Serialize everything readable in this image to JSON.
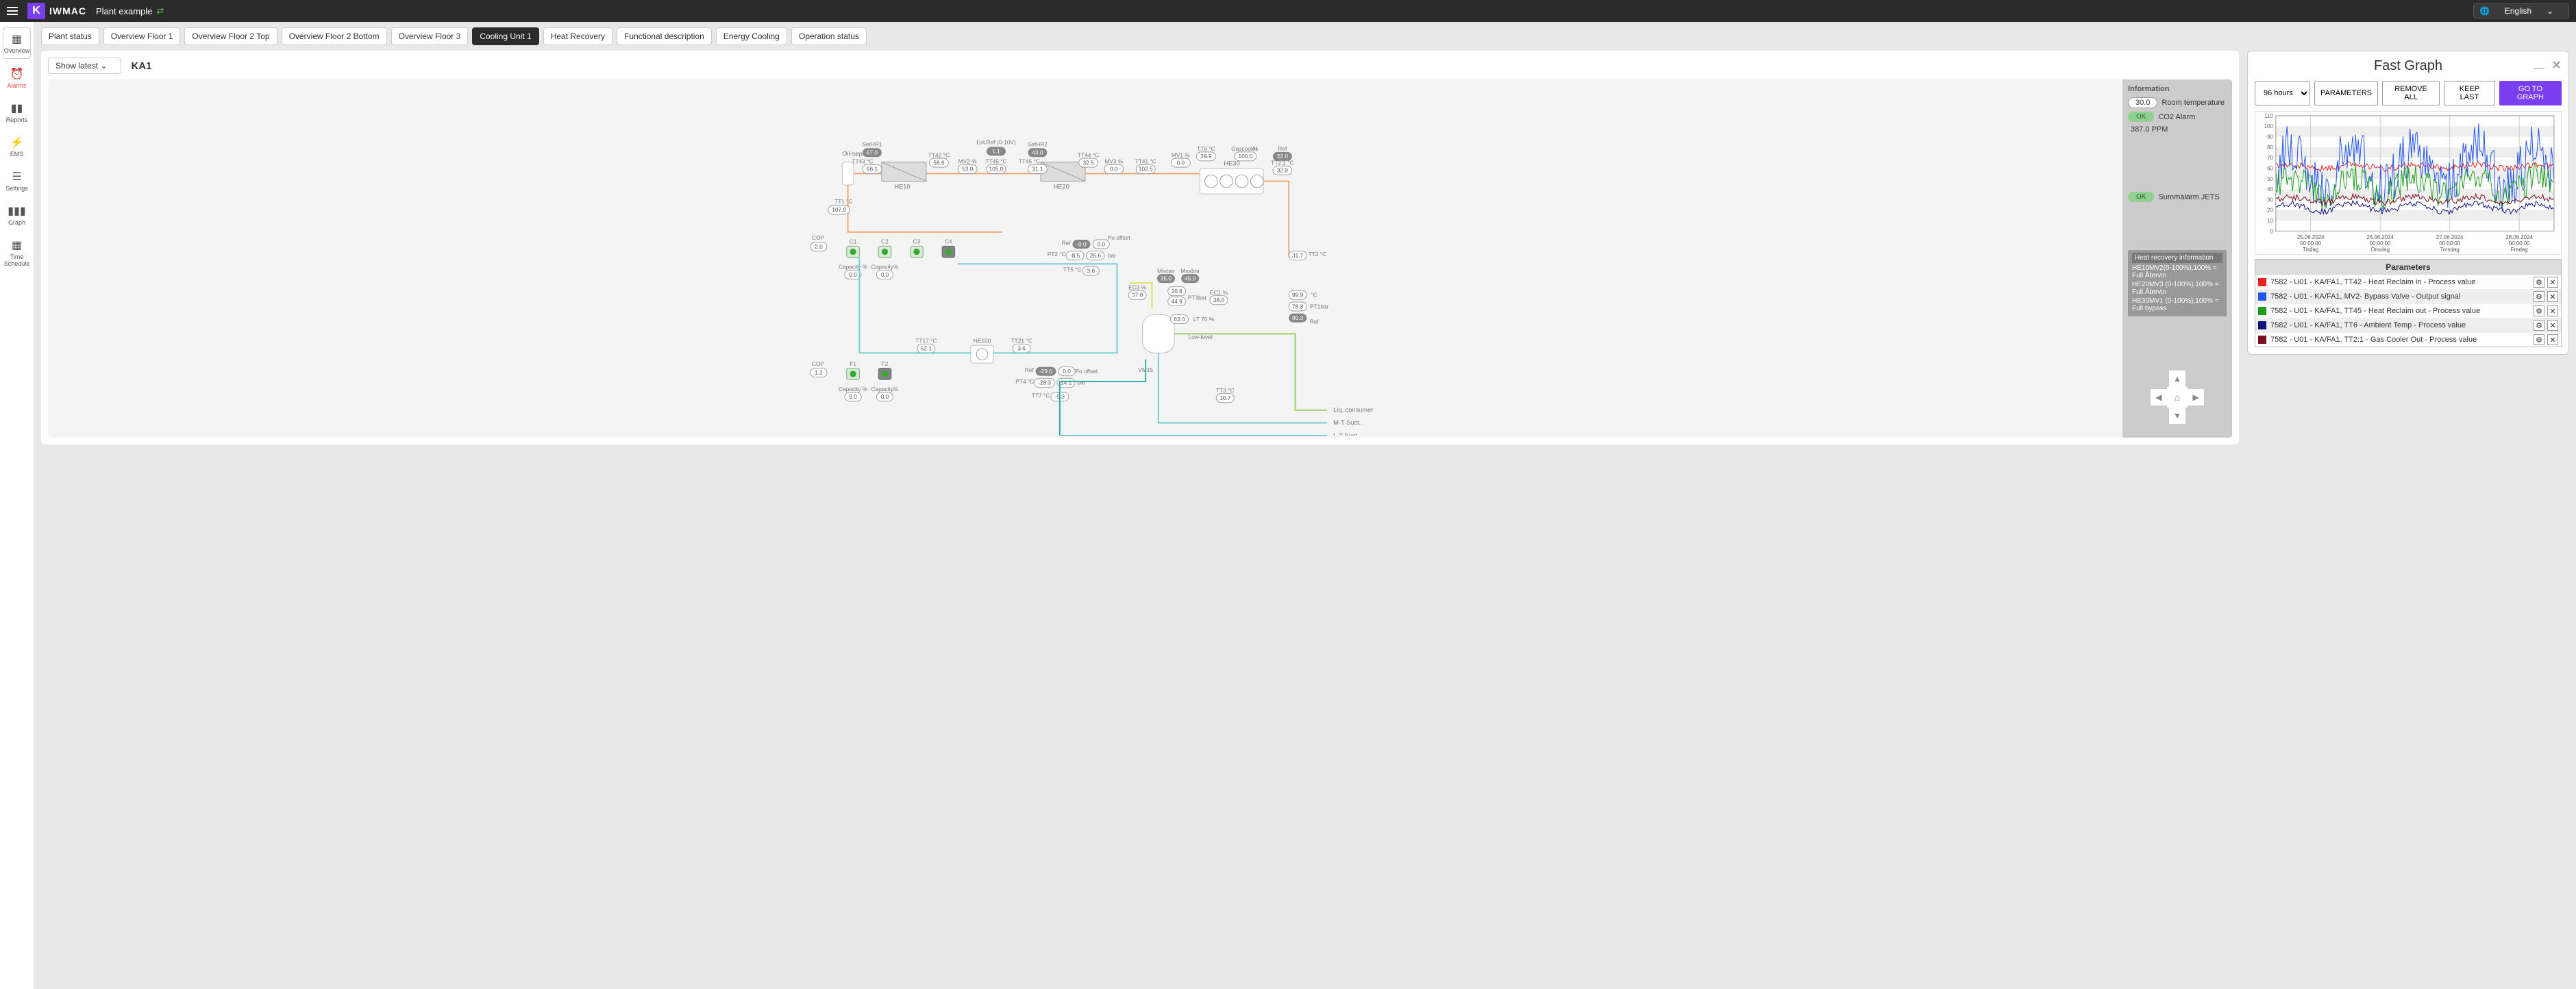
{
  "header": {
    "brand": "IWMAC",
    "plant_name": "Plant example",
    "language_label": "English"
  },
  "sidebar": [
    {
      "key": "overview",
      "label": "Overview",
      "icon": "▦"
    },
    {
      "key": "alarms",
      "label": "Alarms",
      "icon": "⏰"
    },
    {
      "key": "reports",
      "label": "Reports",
      "icon": "▮▮"
    },
    {
      "key": "ems",
      "label": "EMS",
      "icon": "⚡"
    },
    {
      "key": "settings",
      "label": "Settings",
      "icon": "☰"
    },
    {
      "key": "graph",
      "label": "Graph",
      "icon": "▮▮▮"
    },
    {
      "key": "time",
      "label": "Time Schedule",
      "icon": "▦"
    }
  ],
  "tabs": [
    "Plant status",
    "Overview Floor 1",
    "Overview Floor 2 Top",
    "Overview Floor 2 Bottom",
    "Overview Floor 3",
    "Cooling Unit 1",
    "Heat Recovery",
    "Functional description",
    "Energy Cooling",
    "Operation status"
  ],
  "active_tab": "Cooling Unit 1",
  "diagram": {
    "show_latest": "Show latest",
    "title": "KA1",
    "labels": {
      "oil_sep": "Oil-sep.",
      "HE10": "HE10",
      "HE20": "HE20",
      "HE30": "HE30",
      "HE100": "HE100",
      "VM15": "VM15",
      "Gascooler": "Gascooler",
      "ext_ref": "Ext.Ref (0-10V)",
      "low_level": "Low-level",
      "liq_consumer": "Liq. consumer",
      "mt_suct": "M-T Suct.",
      "lt_suct": "L-T Suct.",
      "po_offset": "Po offset"
    },
    "values": {
      "SetHR1": "67.0",
      "TT43": "66.1",
      "TT42": "58.6",
      "MV2": "53.0",
      "ExtRef": "1.1",
      "TT45": "105.0",
      "SetHR2": "43.0",
      "TT45b": "31.1",
      "TT44": "32.5",
      "MV3": "0.0",
      "TT41": "102.5",
      "MV1": "0.0",
      "TT6": "29.9",
      "Gascooler": "100.0",
      "Ref": "22.0",
      "TT21top": "32.9",
      "TT1": "107.9",
      "C1": "C1",
      "C2": "C2",
      "C3": "C3",
      "C4": "C4",
      "COP": "2.0",
      "Capacity1": "0.0",
      "Capacity2": "0.0",
      "Ref2": "-9.0",
      "Ref2_off": "0.0",
      "PT2": "-8.5",
      "PT2b": "26.6",
      "TT5": "3.6",
      "Minbar": "35.0",
      "Maxbar": "45.0",
      "EC3": "37.0",
      "EC1": "38.0",
      "PT3": "10.8",
      "PT3b": "44.9",
      "LT70": "63.0",
      "TT2": "31.7",
      "PT1_a": "99.9",
      "PT1_b": "78.8",
      "PT1_c": "80.3",
      "TT17": "52.1",
      "TT21": "3.6",
      "Ref3": "-29.0",
      "Ref3_off": "0.0",
      "PT4": "-28.3",
      "PT4b": "14.1",
      "TT7": "-9.3",
      "TT3": "10.7",
      "F1": "F1",
      "F2": "F2",
      "COP2": "1.2",
      "Capacity3": "9.0",
      "Capacity4": "0.0"
    }
  },
  "info_panel": {
    "title": "Information",
    "room_temp_val": "30.0",
    "room_temp_label": "Room temperature",
    "co2_ok": "OK",
    "co2_label": "CO2 Alarm",
    "ppm_val": "387.0  PPM",
    "summa_ok": "OK",
    "summa_label": "Summalarm JETS",
    "hr_title": "Heat recovery information",
    "hr_rows": [
      "HE10MV2(0-100%),100% = Full Återvin",
      "HE20MV3 (0-100%),100% = Full Återvin",
      "HE30MV1 (0-100%),100% = Full bypass"
    ]
  },
  "fastgraph": {
    "title": "Fast Graph",
    "range": "96 hours",
    "buttons": {
      "parameters": "PARAMETERS",
      "remove": "REMOVE ALL",
      "keep": "KEEP LAST",
      "go": "GO TO GRAPH"
    },
    "params_header": "Parameters",
    "params": [
      {
        "color": "#e62222",
        "label": "7582 - U01 - KA/FA1, TT42 - Heat Reclaim in - Process value"
      },
      {
        "color": "#2255ee",
        "label": "7582 - U01 - KA/FA1, MV2- Bypass Valve - Output signal"
      },
      {
        "color": "#1a9e1a",
        "label": "7582 - U01 - KA/FA1, TT45 - Heat Reclaim out - Process value"
      },
      {
        "color": "#101080",
        "label": "7582 - U01 - KA/FA1, TT6 - Ambient Temp - Process value"
      },
      {
        "color": "#7a1020",
        "label": "7582 - U01 - KA/FA1, TT2:1 - Gas Cooler Out - Process value"
      }
    ]
  },
  "chart_data": {
    "type": "line",
    "ylim": [
      0,
      110
    ],
    "yticks": [
      0,
      10,
      20,
      30,
      40,
      50,
      60,
      70,
      80,
      90,
      100,
      110
    ],
    "x_dates": [
      {
        "d": "25.06.2024",
        "t": "00:00:00",
        "w": "Tisdag"
      },
      {
        "d": "26.06.2024",
        "t": "00:00:00",
        "w": "Onsdag"
      },
      {
        "d": "27.06.2024",
        "t": "00:00:00",
        "w": "Torsdag"
      },
      {
        "d": "28.06.2024",
        "t": "00:00:00",
        "w": "Fredag"
      }
    ],
    "series": [
      {
        "name": "TT42",
        "color": "#e62222",
        "approx_range": [
          58,
          65
        ]
      },
      {
        "name": "MV2",
        "color": "#2255ee",
        "approx_range": [
          20,
          100
        ],
        "note": "highly oscillating 30–80 with spikes to 100"
      },
      {
        "name": "TT45",
        "color": "#1a9e1a",
        "approx_range": [
          25,
          60
        ],
        "note": "dense oscillation 30–60 daily"
      },
      {
        "name": "TT6",
        "color": "#101080",
        "approx_range": [
          15,
          30
        ]
      },
      {
        "name": "TT2:1",
        "color": "#7a1020",
        "approx_range": [
          25,
          35
        ]
      }
    ]
  }
}
